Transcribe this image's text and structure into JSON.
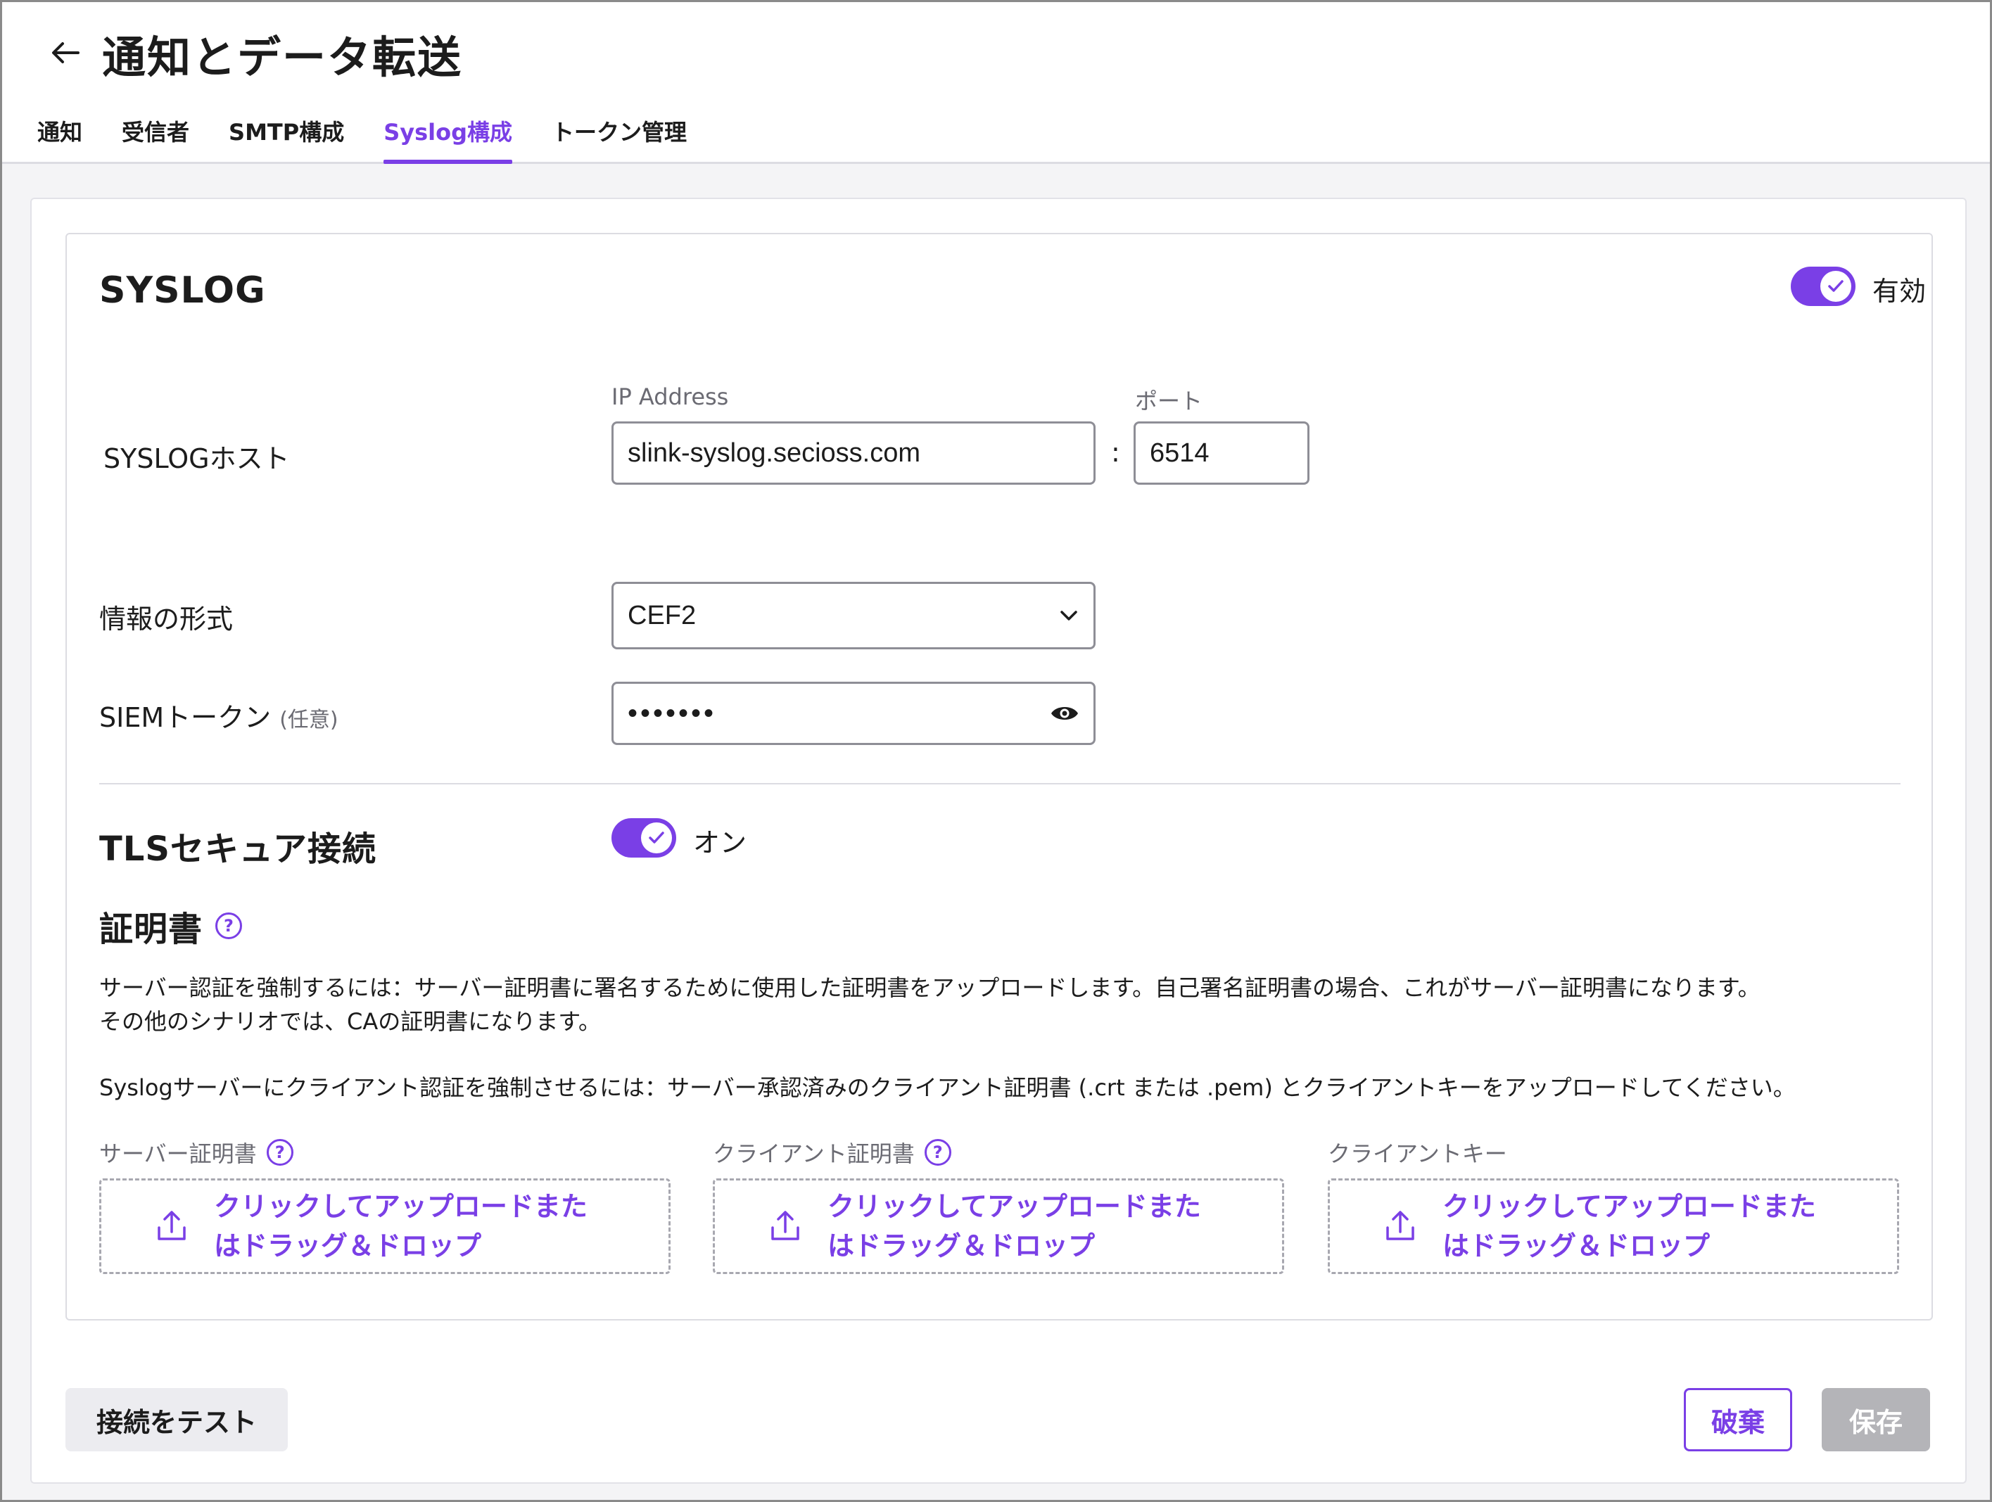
{
  "header": {
    "title": "通知とデータ転送",
    "tabs": [
      {
        "label": "通知",
        "active": false
      },
      {
        "label": "受信者",
        "active": false
      },
      {
        "label": "SMTP構成",
        "active": false
      },
      {
        "label": "Syslog構成",
        "active": true
      },
      {
        "label": "トークン管理",
        "active": false
      }
    ]
  },
  "syslog": {
    "title": "SYSLOG",
    "enabled_label": "有効",
    "host_label": "SYSLOGホスト",
    "ip_label": "IP Address",
    "ip_value": "slink-syslog.secioss.com",
    "colon": ":",
    "port_label": "ポート",
    "port_value": "6514",
    "format_label": "情報の形式",
    "format_value": "CEF2",
    "token_label": "SIEMトークン",
    "token_optional": "(任意)",
    "token_value": "•••••••"
  },
  "tls": {
    "title": "TLSセキュア接続",
    "toggle_label": "オン"
  },
  "certificate": {
    "title": "証明書",
    "help": "?",
    "desc_line1": "サーバー認証を強制するには：サーバー証明書に署名するために使用した証明書をアップロードします。自己署名証明書の場合、これがサーバー証明書になります。",
    "desc_line2": "その他のシナリオでは、CAの証明書になります。",
    "desc_line3": "Syslogサーバーにクライアント認証を強制させるには：サーバー承認済みのクライアント証明書 (.crt または .pem) とクライアントキーをアップロードしてください。",
    "uploads": [
      {
        "label": "サーバー証明書",
        "line1": "クリックしてアップロードまた",
        "line2": "はドラッグ＆ドロップ"
      },
      {
        "label": "クライアント証明書",
        "line1": "クリックしてアップロードまた",
        "line2": "はドラッグ＆ドロップ"
      },
      {
        "label": "クライアントキー",
        "line1": "クリックしてアップロードまた",
        "line2": "はドラッグ＆ドロップ"
      }
    ]
  },
  "footer": {
    "test_label": "接続をテスト",
    "discard_label": "破棄",
    "save_label": "保存"
  },
  "colors": {
    "accent": "#7a3fe6",
    "disabled": "#b4b4b8"
  }
}
